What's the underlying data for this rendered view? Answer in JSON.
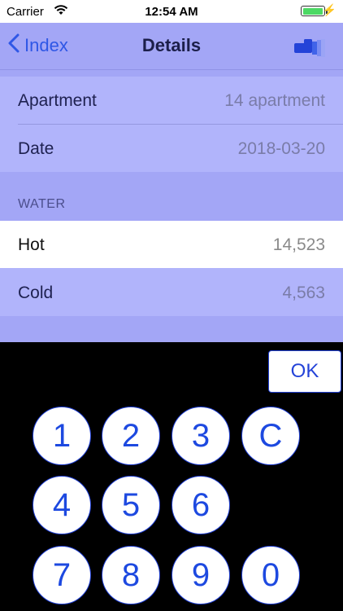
{
  "status_bar": {
    "carrier": "Carrier",
    "time": "12:54 AM"
  },
  "nav": {
    "back_label": "Index",
    "title": "Details"
  },
  "details": {
    "apartment": {
      "label": "Apartment",
      "value": "14 apartment"
    },
    "date": {
      "label": "Date",
      "value": "2018-03-20"
    }
  },
  "water": {
    "header": "WATER",
    "hot": {
      "label": "Hot",
      "value": "14,523"
    },
    "cold": {
      "label": "Cold",
      "value": "4,563"
    }
  },
  "keypad": {
    "ok_label": "OK",
    "keys": [
      "1",
      "2",
      "3",
      "C",
      "4",
      "5",
      "6",
      "7",
      "8",
      "9",
      "0"
    ]
  },
  "colors": {
    "accent": "#2443d8",
    "background": "#a3a6f6",
    "cell": "#b1b4fb"
  },
  "icons": {
    "back": "chevron-left-icon",
    "action": "meter-icon",
    "wifi": "wifi-icon",
    "battery": "battery-icon",
    "charging": "bolt-icon"
  }
}
